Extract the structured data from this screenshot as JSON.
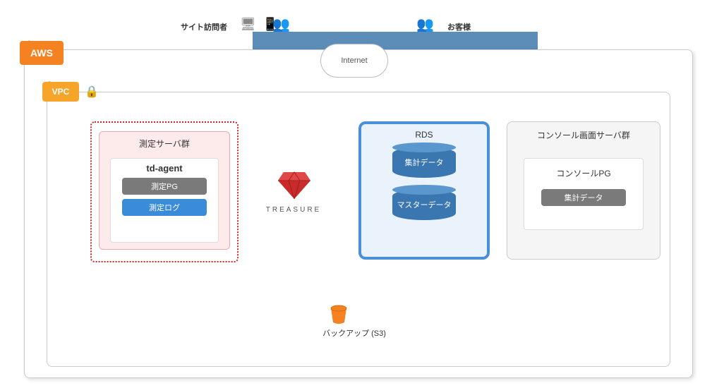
{
  "top": {
    "left_label": "サイト訪問者",
    "right_label": "お客様"
  },
  "cloud": {
    "aws_label": "AWS",
    "vpc_label": "VPC",
    "internet_label": "Internet"
  },
  "server_group": {
    "title": "測定サーバ群",
    "tdagent_title": "td-agent",
    "chip_pg": "測定PG",
    "chip_log": "測定ログ"
  },
  "treasure": {
    "label": "TREASURE"
  },
  "rds": {
    "title": "RDS",
    "db1": "集計データ",
    "db2": "マスターデータ"
  },
  "console": {
    "title": "コンソール画面サーバ群",
    "inner_title": "コンソールPG",
    "chip": "集計データ"
  },
  "backup": {
    "label": "バックアップ (S3)"
  },
  "icons": {
    "devices": "devices-icon",
    "people": "people-icon",
    "lock": "lock-icon",
    "bucket": "bucket-icon",
    "gem": "treasure-gem-icon",
    "cloud_aws": "aws-cloud-icon",
    "cloud_vpc": "vpc-cloud-icon"
  },
  "colors": {
    "aws_orange": "#f58220",
    "vpc_orange": "#f7a52a",
    "red": "#c92a2a",
    "blue": "#4a90d9",
    "db_blue": "#3a77b0",
    "gray": "#7a7a7a",
    "chip_blue": "#3a8bd8",
    "topbar_blue": "#5b8db8"
  }
}
